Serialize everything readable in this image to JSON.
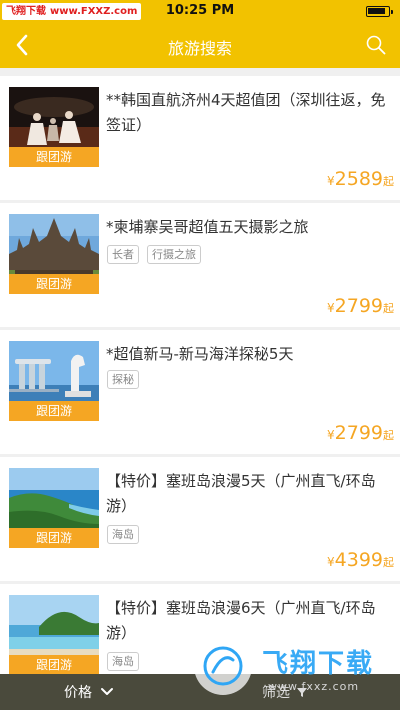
{
  "status": {
    "time": "10:25 PM"
  },
  "watermark_top": {
    "brand": "飞翔下载",
    "url": "www.FXXZ.com"
  },
  "nav": {
    "title": "旅游搜索"
  },
  "items": [
    {
      "title": "**韩国直航济州4天超值团（深圳往返，免签证）",
      "tag": "跟团游",
      "labels": [],
      "price_symbol": "¥",
      "price": "2589",
      "price_unit": "起"
    },
    {
      "title": "*柬埔寨吴哥超值五天摄影之旅",
      "tag": "跟团游",
      "labels": [
        "长者",
        "行摄之旅"
      ],
      "price_symbol": "¥",
      "price": "2799",
      "price_unit": "起"
    },
    {
      "title": "*超值新马-新马海洋探秘5天",
      "tag": "跟团游",
      "labels": [
        "探秘"
      ],
      "price_symbol": "¥",
      "price": "2799",
      "price_unit": "起"
    },
    {
      "title": "【特价】塞班岛浪漫5天（广州直飞/环岛游）",
      "tag": "跟团游",
      "labels": [
        "海岛"
      ],
      "price_symbol": "¥",
      "price": "4399",
      "price_unit": "起"
    },
    {
      "title": "【特价】塞班岛浪漫6天（广州直飞/环岛游）",
      "tag": "跟团游",
      "labels": [
        "海岛"
      ],
      "price_symbol": "¥",
      "price": "",
      "price_unit": ""
    }
  ],
  "bottom_bar": {
    "price_filter": "价格",
    "other_filter": "筛选"
  },
  "watermark_bottom": {
    "brand": "飞翔下载",
    "url": "www.fxxz.com"
  }
}
